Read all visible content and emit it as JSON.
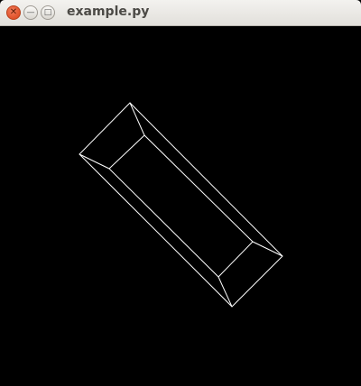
{
  "window": {
    "title": "example.py",
    "controls": {
      "close_icon": "close-icon",
      "minimize_icon": "minimize-icon",
      "maximize_icon": "maximize-icon"
    }
  },
  "canvas": {
    "background": "#000000",
    "stroke": "#ffffff",
    "shape": "wireframe-frustum-box"
  }
}
